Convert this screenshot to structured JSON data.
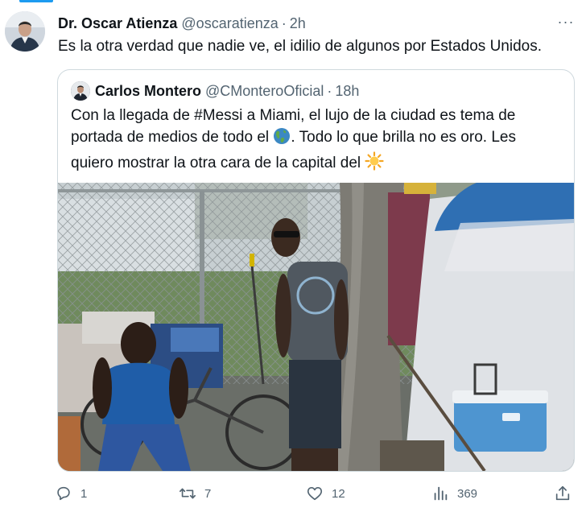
{
  "tweet": {
    "author_name": "Dr. Oscar Atienza",
    "author_handle": "@oscaratienza",
    "separator": "·",
    "time": "2h",
    "more_label": "···",
    "text": "Es la otra verdad que nadie ve, el idilio de algunos por Estados Unidos."
  },
  "quote": {
    "author_name": "Carlos Montero",
    "author_handle": "@CMonteroOficial",
    "separator": "·",
    "time": "18h",
    "text_part1": "Con la llegada de #Messi a Miami, el lujo de la ciudad es tema de portada de medios de todo el ",
    "text_part2": ". Todo lo que brilla no es oro. Les quiero mostrar la otra cara de la capital del ",
    "emoji1": "globe-americas-icon",
    "emoji2": "sun-icon"
  },
  "actions": {
    "reply_count": "1",
    "retweet_count": "7",
    "like_count": "12",
    "views_count": "369"
  },
  "colors": {
    "accent": "#1d9bf0",
    "secondary_text": "#536471",
    "border": "#cfd9de"
  }
}
